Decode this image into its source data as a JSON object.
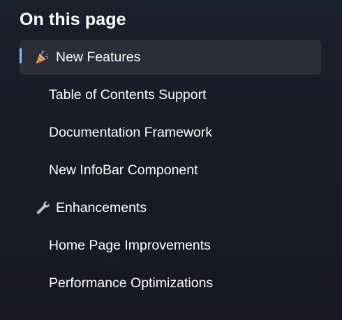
{
  "toc": {
    "heading": "On this page",
    "items": [
      {
        "label": "New Features",
        "level": 1,
        "icon": "party-popper-icon",
        "active": true
      },
      {
        "label": "Table of Contents Support",
        "level": 2
      },
      {
        "label": "Documentation Framework",
        "level": 2
      },
      {
        "label": "New InfoBar Component",
        "level": 2
      },
      {
        "label": "Enhancements",
        "level": 1,
        "icon": "wrench-icon"
      },
      {
        "label": "Home Page Improvements",
        "level": 2
      },
      {
        "label": "Performance Optimizations",
        "level": 2
      }
    ]
  },
  "colors": {
    "background": "#1a1c28",
    "text": "#ffffff",
    "active_marker": "#7cc4ff"
  }
}
